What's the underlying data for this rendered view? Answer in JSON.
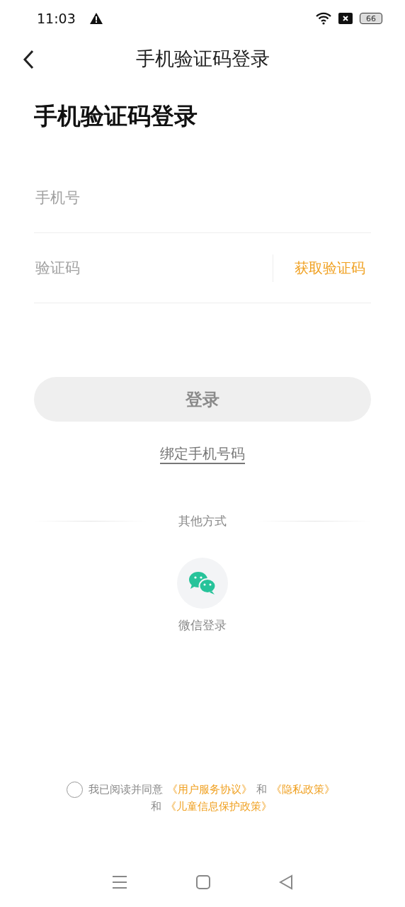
{
  "status_bar": {
    "time": "11:03",
    "battery": "66"
  },
  "nav": {
    "title": "手机验证码登录"
  },
  "heading": "手机验证码登录",
  "fields": [
    {
      "placeholder": "手机号"
    },
    {
      "placeholder": "验证码",
      "action": "获取验证码"
    }
  ],
  "login_button": {
    "label": "登录",
    "disabled": true
  },
  "bind_link": "绑定手机号码",
  "other_methods": {
    "title": "其他方式",
    "items": [
      {
        "kind": "wechat",
        "label": "微信登录"
      }
    ]
  },
  "agreement": {
    "checked": false,
    "parts": [
      {
        "kind": "text",
        "text": "我已阅读并同意"
      },
      {
        "kind": "link",
        "text": "《用户服务协议》"
      },
      {
        "kind": "text",
        "text": "和"
      },
      {
        "kind": "link",
        "text": "《隐私政策》"
      },
      {
        "kind": "break"
      },
      {
        "kind": "text",
        "text": "和"
      },
      {
        "kind": "link",
        "text": "《儿童信息保护政策》"
      }
    ]
  }
}
